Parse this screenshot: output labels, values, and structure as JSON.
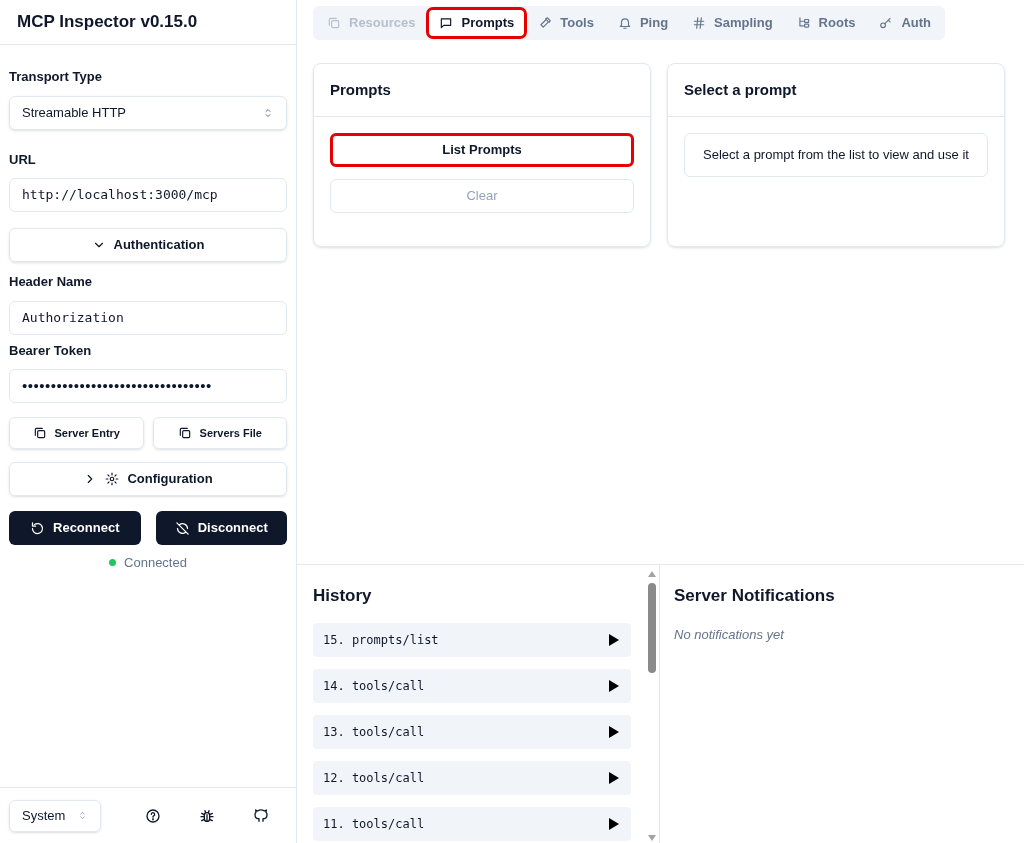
{
  "sidebar": {
    "title": "MCP Inspector v0.15.0",
    "transport": {
      "label": "Transport Type",
      "value": "Streamable HTTP"
    },
    "url": {
      "label": "URL",
      "value": "http://localhost:3000/mcp"
    },
    "authentication": {
      "label": "Authentication",
      "expanded": true
    },
    "header_name": {
      "label": "Header Name",
      "value": "Authorization"
    },
    "bearer_token": {
      "label": "Bearer Token",
      "value": "•••••••••••••••••••••••••••••••••"
    },
    "copy_buttons": [
      "Server Entry",
      "Servers File"
    ],
    "configuration": {
      "label": "Configuration",
      "expanded": false
    },
    "actions": [
      {
        "label": "Reconnect",
        "kind": "reconnect"
      },
      {
        "label": "Disconnect",
        "kind": "disconnect"
      }
    ],
    "status": {
      "label": "Connected",
      "color": "#22c55e"
    },
    "theme": {
      "value": "System"
    }
  },
  "tabs": [
    {
      "label": "Resources",
      "selected": false,
      "disabled": true,
      "highlighted": false
    },
    {
      "label": "Prompts",
      "selected": true,
      "disabled": false,
      "highlighted": true
    },
    {
      "label": "Tools",
      "selected": false,
      "disabled": false,
      "highlighted": false
    },
    {
      "label": "Ping",
      "selected": false,
      "disabled": false,
      "highlighted": false
    },
    {
      "label": "Sampling",
      "selected": false,
      "disabled": false,
      "highlighted": false
    },
    {
      "label": "Roots",
      "selected": false,
      "disabled": false,
      "highlighted": false
    },
    {
      "label": "Auth",
      "selected": false,
      "disabled": false,
      "highlighted": false
    }
  ],
  "prompts_panel": {
    "title": "Prompts",
    "buttons": [
      {
        "label": "List Prompts",
        "disabled": false,
        "highlighted": true
      },
      {
        "label": "Clear",
        "disabled": true,
        "highlighted": false
      }
    ]
  },
  "detail_panel": {
    "title": "Select a prompt",
    "message": "Select a prompt from the list to view and use it"
  },
  "history": {
    "title": "History",
    "items": [
      "15. prompts/list",
      "14. tools/call",
      "13. tools/call",
      "12. tools/call",
      "11. tools/call"
    ]
  },
  "notifications": {
    "title": "Server Notifications",
    "empty": "No notifications yet"
  }
}
